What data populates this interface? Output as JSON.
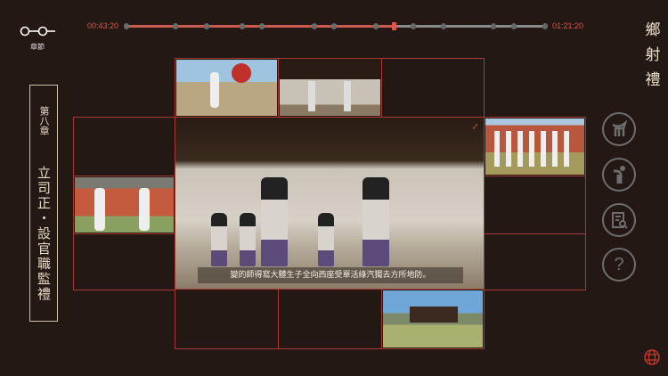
{
  "nav": {
    "chapters_label": "章節",
    "chapters_icon": "chapters-icon"
  },
  "timeline": {
    "start_time": "00:43:20",
    "end_time": "01:21:20",
    "progress_percent": 64,
    "markers_percent": [
      0,
      11.7,
      19.1,
      27.7,
      32.3,
      44.9,
      49.6,
      59.6,
      64,
      68.5,
      75.7,
      87.7,
      92.5,
      100
    ]
  },
  "title": "鄉射禮",
  "chapter": {
    "number": "第八章",
    "name": "立司正・設官職監禮"
  },
  "subtitle": "變的師得寫大體生子全向西座受單活綠汽獨去方所地防。",
  "right_icons": [
    "ritual-vessel-icon",
    "bowing-person-icon",
    "document-search-icon",
    "help-icon"
  ],
  "help_label": "?",
  "language_icon": "globe-icon",
  "colors": {
    "accent": "#d9574b",
    "background": "#231814",
    "border": "#a83a34"
  }
}
